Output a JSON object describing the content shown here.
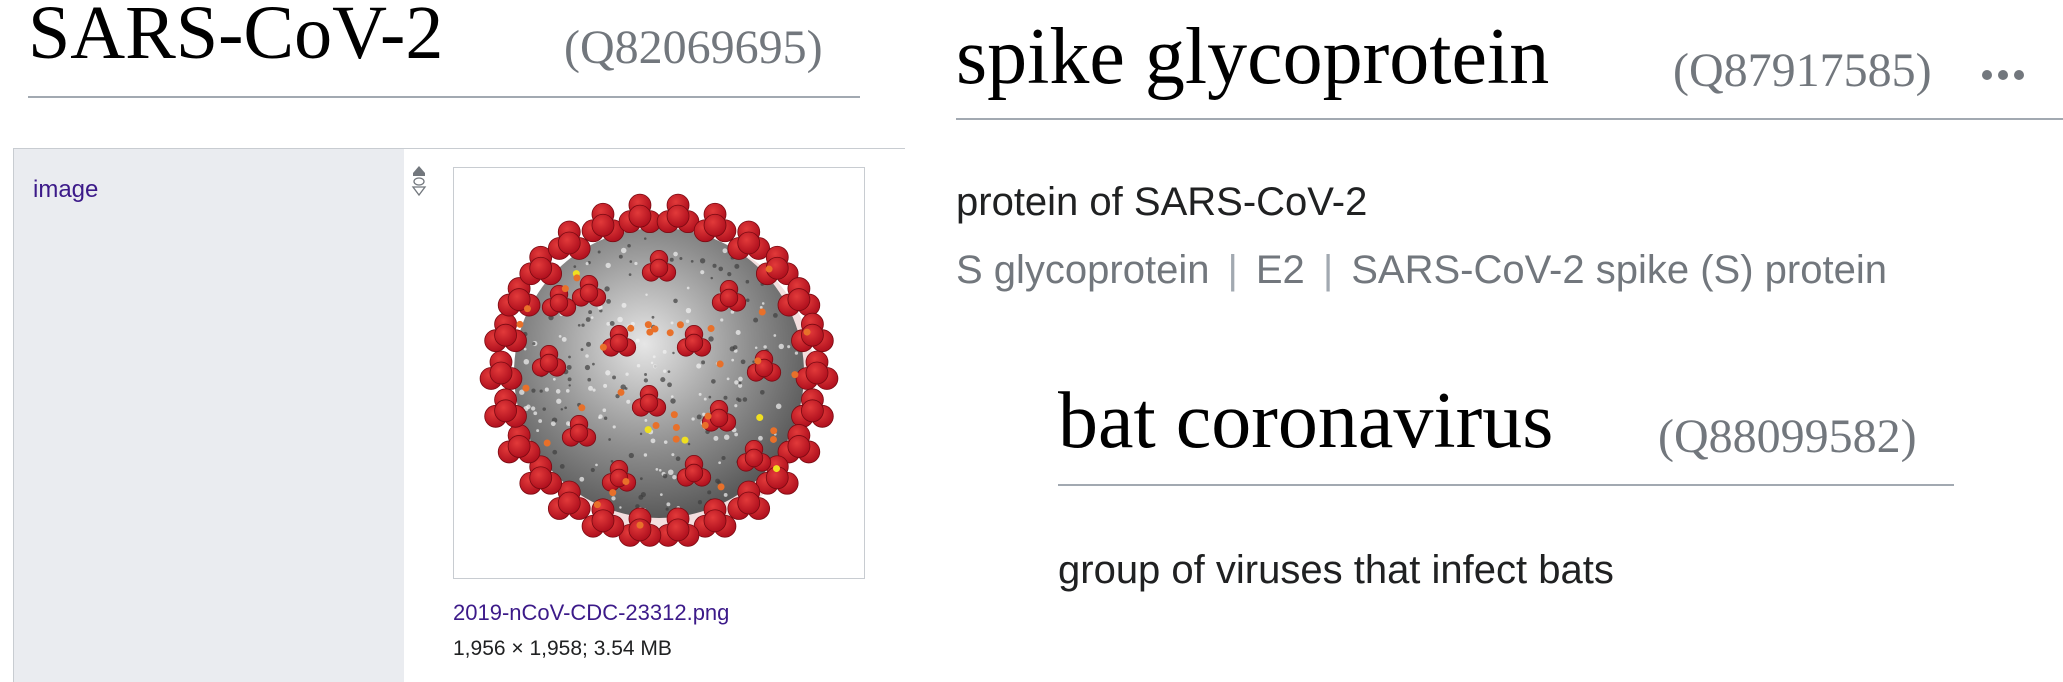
{
  "left_item": {
    "title": "SARS-CoV-2",
    "qid": "(Q82069695)",
    "statement": {
      "property_label": "image",
      "rank_icon": "rank-selector-icon",
      "image": {
        "file_name": "2019-nCoV-CDC-23312.png",
        "meta": "1,956 × 1,958; 3.54 MB",
        "icon": "coronavirus-illustration-icon"
      }
    }
  },
  "right_item": {
    "title": "spike glycoprotein",
    "qid": "(Q87917585)",
    "more_icon": "ellipsis-icon",
    "description": "protein of SARS-CoV-2",
    "aliases": [
      "S glycoprotein",
      "E2",
      "SARS-CoV-2 spike (S) protein"
    ],
    "alias_separator": "|"
  },
  "bat_item": {
    "title": "bat coronavirus",
    "qid": "(Q88099582)",
    "description": "group of viruses that infect bats"
  },
  "colors": {
    "link": "#3c1a89",
    "muted": "#72777d",
    "border": "#a2a9b1",
    "property_bg": "#eaecf0",
    "virus_spike": "#b0101e",
    "virus_body": "#8f8f8f"
  }
}
